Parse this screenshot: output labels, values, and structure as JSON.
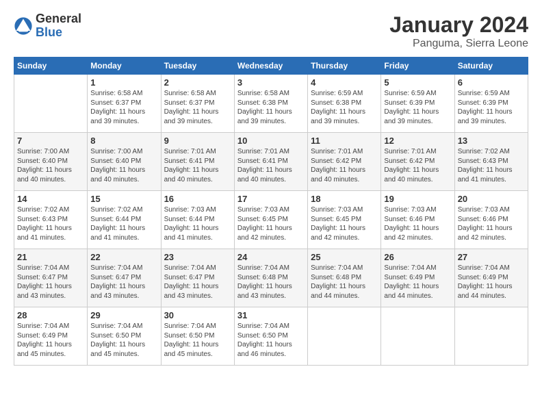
{
  "logo": {
    "general": "General",
    "blue": "Blue"
  },
  "title": "January 2024",
  "subtitle": "Panguma, Sierra Leone",
  "days_header": [
    "Sunday",
    "Monday",
    "Tuesday",
    "Wednesday",
    "Thursday",
    "Friday",
    "Saturday"
  ],
  "weeks": [
    [
      {
        "day": "",
        "detail": ""
      },
      {
        "day": "1",
        "detail": "Sunrise: 6:58 AM\nSunset: 6:37 PM\nDaylight: 11 hours\nand 39 minutes."
      },
      {
        "day": "2",
        "detail": "Sunrise: 6:58 AM\nSunset: 6:37 PM\nDaylight: 11 hours\nand 39 minutes."
      },
      {
        "day": "3",
        "detail": "Sunrise: 6:58 AM\nSunset: 6:38 PM\nDaylight: 11 hours\nand 39 minutes."
      },
      {
        "day": "4",
        "detail": "Sunrise: 6:59 AM\nSunset: 6:38 PM\nDaylight: 11 hours\nand 39 minutes."
      },
      {
        "day": "5",
        "detail": "Sunrise: 6:59 AM\nSunset: 6:39 PM\nDaylight: 11 hours\nand 39 minutes."
      },
      {
        "day": "6",
        "detail": "Sunrise: 6:59 AM\nSunset: 6:39 PM\nDaylight: 11 hours\nand 39 minutes."
      }
    ],
    [
      {
        "day": "7",
        "detail": "Sunrise: 7:00 AM\nSunset: 6:40 PM\nDaylight: 11 hours\nand 40 minutes."
      },
      {
        "day": "8",
        "detail": "Sunrise: 7:00 AM\nSunset: 6:40 PM\nDaylight: 11 hours\nand 40 minutes."
      },
      {
        "day": "9",
        "detail": "Sunrise: 7:01 AM\nSunset: 6:41 PM\nDaylight: 11 hours\nand 40 minutes."
      },
      {
        "day": "10",
        "detail": "Sunrise: 7:01 AM\nSunset: 6:41 PM\nDaylight: 11 hours\nand 40 minutes."
      },
      {
        "day": "11",
        "detail": "Sunrise: 7:01 AM\nSunset: 6:42 PM\nDaylight: 11 hours\nand 40 minutes."
      },
      {
        "day": "12",
        "detail": "Sunrise: 7:01 AM\nSunset: 6:42 PM\nDaylight: 11 hours\nand 40 minutes."
      },
      {
        "day": "13",
        "detail": "Sunrise: 7:02 AM\nSunset: 6:43 PM\nDaylight: 11 hours\nand 41 minutes."
      }
    ],
    [
      {
        "day": "14",
        "detail": "Sunrise: 7:02 AM\nSunset: 6:43 PM\nDaylight: 11 hours\nand 41 minutes."
      },
      {
        "day": "15",
        "detail": "Sunrise: 7:02 AM\nSunset: 6:44 PM\nDaylight: 11 hours\nand 41 minutes."
      },
      {
        "day": "16",
        "detail": "Sunrise: 7:03 AM\nSunset: 6:44 PM\nDaylight: 11 hours\nand 41 minutes."
      },
      {
        "day": "17",
        "detail": "Sunrise: 7:03 AM\nSunset: 6:45 PM\nDaylight: 11 hours\nand 42 minutes."
      },
      {
        "day": "18",
        "detail": "Sunrise: 7:03 AM\nSunset: 6:45 PM\nDaylight: 11 hours\nand 42 minutes."
      },
      {
        "day": "19",
        "detail": "Sunrise: 7:03 AM\nSunset: 6:46 PM\nDaylight: 11 hours\nand 42 minutes."
      },
      {
        "day": "20",
        "detail": "Sunrise: 7:03 AM\nSunset: 6:46 PM\nDaylight: 11 hours\nand 42 minutes."
      }
    ],
    [
      {
        "day": "21",
        "detail": "Sunrise: 7:04 AM\nSunset: 6:47 PM\nDaylight: 11 hours\nand 43 minutes."
      },
      {
        "day": "22",
        "detail": "Sunrise: 7:04 AM\nSunset: 6:47 PM\nDaylight: 11 hours\nand 43 minutes."
      },
      {
        "day": "23",
        "detail": "Sunrise: 7:04 AM\nSunset: 6:47 PM\nDaylight: 11 hours\nand 43 minutes."
      },
      {
        "day": "24",
        "detail": "Sunrise: 7:04 AM\nSunset: 6:48 PM\nDaylight: 11 hours\nand 43 minutes."
      },
      {
        "day": "25",
        "detail": "Sunrise: 7:04 AM\nSunset: 6:48 PM\nDaylight: 11 hours\nand 44 minutes."
      },
      {
        "day": "26",
        "detail": "Sunrise: 7:04 AM\nSunset: 6:49 PM\nDaylight: 11 hours\nand 44 minutes."
      },
      {
        "day": "27",
        "detail": "Sunrise: 7:04 AM\nSunset: 6:49 PM\nDaylight: 11 hours\nand 44 minutes."
      }
    ],
    [
      {
        "day": "28",
        "detail": "Sunrise: 7:04 AM\nSunset: 6:49 PM\nDaylight: 11 hours\nand 45 minutes."
      },
      {
        "day": "29",
        "detail": "Sunrise: 7:04 AM\nSunset: 6:50 PM\nDaylight: 11 hours\nand 45 minutes."
      },
      {
        "day": "30",
        "detail": "Sunrise: 7:04 AM\nSunset: 6:50 PM\nDaylight: 11 hours\nand 45 minutes."
      },
      {
        "day": "31",
        "detail": "Sunrise: 7:04 AM\nSunset: 6:50 PM\nDaylight: 11 hours\nand 46 minutes."
      },
      {
        "day": "",
        "detail": ""
      },
      {
        "day": "",
        "detail": ""
      },
      {
        "day": "",
        "detail": ""
      }
    ]
  ]
}
